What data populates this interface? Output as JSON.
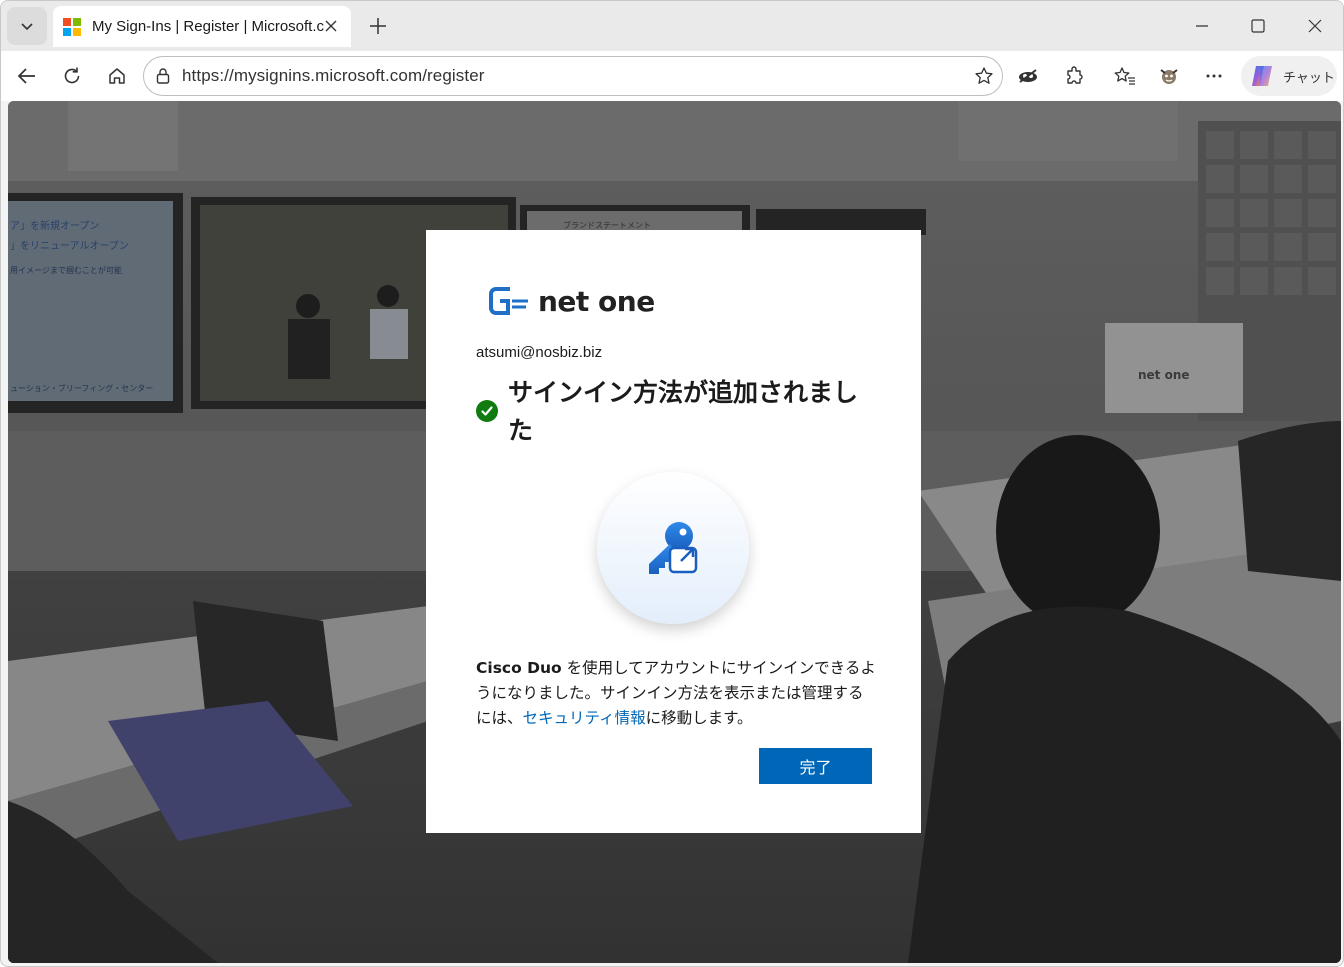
{
  "browser": {
    "tab_title": "My Sign-Ins | Register | Microsoft.com",
    "url": "https://mysignins.microsoft.com/register",
    "copilot_label": "チャット"
  },
  "card": {
    "brand": "net one",
    "email": "atsumi@nosbiz.biz",
    "title": "サインイン方法が追加されました",
    "desc_method": "Cisco Duo",
    "desc_part1": " を使用してアカウントにサインインできるようになりました。サインイン方法を表示または管理するには、",
    "desc_link": "セキュリティ情報",
    "desc_part2": "に移動します。",
    "done_label": "完了"
  },
  "background": {
    "screen_text": [
      "ア」を新規オープン",
      "」をリニューアルオープン",
      "用イメージまで掴むことが可能",
      "ューション・ブリーフィング・センター",
      "ブランドステートメント"
    ],
    "desk_sign": "net one"
  },
  "colors": {
    "accent": "#0067b8",
    "success": "#107c10",
    "brand_blue": "#1f6fc6"
  },
  "icons": [
    "tab-actions-icon",
    "microsoft-logo-icon",
    "close-icon",
    "plus-icon",
    "minimize-icon",
    "maximize-icon",
    "back-icon",
    "refresh-icon",
    "home-icon",
    "lock-icon",
    "favorite-star-icon",
    "tracking-icon",
    "extensions-icon",
    "favorites-icon",
    "profile-icon",
    "more-icon",
    "copilot-icon",
    "key-external-icon",
    "checkmark-icon"
  ]
}
